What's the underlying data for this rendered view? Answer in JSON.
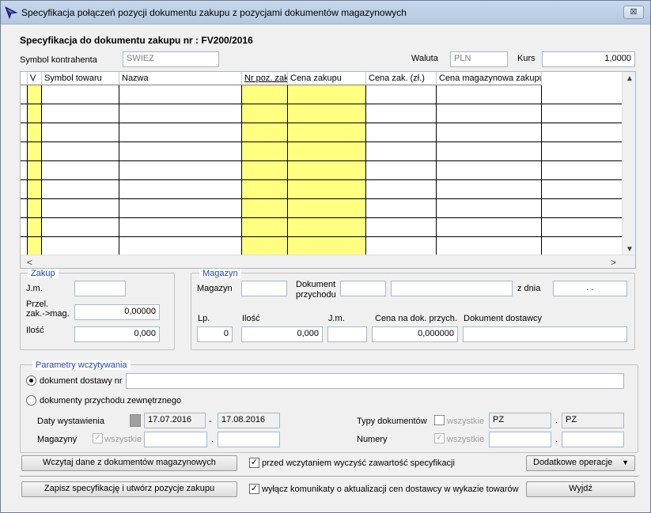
{
  "window": {
    "title": "Specyfikacja połączeń pozycji dokumentu zakupu z pozycjami dokumentów magazynowych",
    "close_glyph": "⊠"
  },
  "header": {
    "doc_title": "Specyfikacja do dokumentu zakupu nr : FV200/2016",
    "contractor_label": "Symbol kontrahenta",
    "contractor_value": "SWIEZ",
    "currency_label": "Waluta",
    "currency_value": "PLN",
    "rate_label": "Kurs",
    "rate_value": "1,0000"
  },
  "grid": {
    "columns": [
      "V",
      "Symbol towaru",
      "Nazwa",
      "Nr poz. zak.",
      "Cena zakupu",
      "Cena zak. (zł.)",
      "Cena magazynowa zakupu"
    ],
    "row_count": 9,
    "scroll_up": "▲",
    "scroll_down": "▼",
    "scroll_left": "<",
    "scroll_right": ">"
  },
  "zakup": {
    "title": "Zakup",
    "jm_label": "J.m.",
    "przel_label": "Przel.\nzak.->mag.",
    "przel_value": "0,00000",
    "ilosc_label": "Ilość",
    "ilosc_value": "0,000"
  },
  "magazyn": {
    "title": "Magazyn",
    "magazyn_label": "Magazyn",
    "dok_label": "Dokument\nprzychodu",
    "z_dnia_label": "z dnia",
    "z_dnia_value": ". .",
    "lp_label": "Lp.",
    "lp_value": "0",
    "ilosc_label": "Ilość",
    "ilosc_value": "0,000",
    "jm_label": "J.m.",
    "cena_label": "Cena na dok. przych.",
    "cena_value": "0,000000",
    "dostawcy_label": "Dokument dostawcy"
  },
  "params": {
    "title": "Parametry wczytywania",
    "radio1_label": "dokument dostawy nr",
    "radio2_label": "dokumenty przychodu zewnętrznego",
    "daty_label": "Daty wystawienia",
    "date_from": "17.07.2016",
    "date_sep": "-",
    "date_to": "17.08.2016",
    "magazyny_label": "Magazyny",
    "wszystkie_label": "wszystkie",
    "dot_sep": ".",
    "typy_label": "Typy dokumentów",
    "typ_from": "PZ",
    "typ_to": "PZ",
    "numery_label": "Numery",
    "check_glyph": "✓"
  },
  "actions": {
    "load_button": "Wczytaj dane z dokumentów magazynowych",
    "clear_check_label": "przed wczytaniem wyczyść zawartość specyfikacji",
    "extra_button": "Dodatkowe operacje",
    "extra_arrow": "▼",
    "save_button": "Zapisz specyfikację i utwórz pozycje zakupu",
    "disable_msgs_label": "wyłącz komunikaty o aktualizacji cen dostawcy w wykazie towarów",
    "exit_button": "Wyjdź"
  }
}
